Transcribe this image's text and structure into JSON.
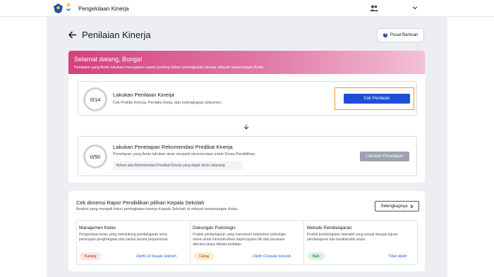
{
  "topbar": {
    "app_name": "Pengelolaan Kinerja",
    "user_icon": "user-group-icon",
    "menu_icon": "chevron-down-icon"
  },
  "header": {
    "title": "Penilaian Kinerja",
    "help_label": "Pusat Bantuan"
  },
  "banner": {
    "title": "Selamat datang, Bunga!",
    "subtitle": "Penilaian yang Anda lakukan merupakan aspek penting dalam peningkatan kinerja wilayah kewenangan Anda."
  },
  "steps": [
    {
      "progress": "0/14",
      "title": "Lakukan Penilaian Kinerja",
      "desc": "Cek Praktik Kinerja, Perilaku Kerja, dan kelengkapan dokumen.",
      "button": "Cek Penilaian"
    },
    {
      "progress": "0/50",
      "title": "Lakukan Penetapan Rekomendasi Predikat Kinerja",
      "desc": "Penetapan yang Anda lakukan akan menjadi rekomendasi untuk Dinas Pendidikan.",
      "button": "Lakukan Penetapan",
      "info": "Belum ada Rekomendasi Predikat Kinerja yang dapat dicek sekarang"
    }
  ],
  "dimensions": {
    "title": "Cek dimensi Rapor Pendidikan pilihan Kepala Sekolah",
    "subtitle": "Berikut yang menjadi fokus peningkatan kinerja Kepala Sekolah di wilayah kewenangan Anda.",
    "more_label": "Selengkapnya",
    "items": [
      {
        "title": "Manajemen Kelas",
        "desc": "Pengelolaan kelas yang mendukung pembelajaran serta penerapan penghargaan dan sanksi secara proporsional.",
        "badge": "Kurang",
        "link": "Dipilih 22 Kepala Sekolah"
      },
      {
        "title": "Dukungan Psikologis",
        "desc": "Praktik pembelajaran yang memenuhi kebutuhan psikologis siswa untuk menumbuhkan kepercayaan diri dan perasaan diterima tanpa dibeda-bedakan.",
        "badge": "Cukup",
        "link": "Dipilih 6 Kepala Sekolah"
      },
      {
        "title": "Metode Pembelajaran",
        "desc": "Praktik pembelajaran interaktif yang sesuai dengan tujuan pembelajaran dan karakteristik siswa.",
        "badge": "Baik",
        "link": "Tidak dipilih"
      }
    ]
  },
  "colors": {
    "accent": "#1d4ed8",
    "banner_start": "#d6407f",
    "badge_kurang": "#fde4e4",
    "badge_cukup": "#fdeccd",
    "badge_baik": "#d8f3dc"
  }
}
